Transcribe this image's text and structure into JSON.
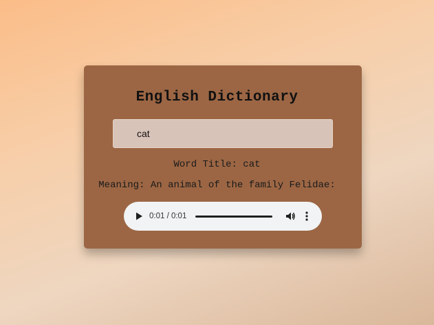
{
  "app": {
    "title": "English Dictionary"
  },
  "search": {
    "value": "cat",
    "placeholder": ""
  },
  "result": {
    "word_title": "Word Title: cat",
    "meaning": "Meaning: An animal of the family Felidae:"
  },
  "audio": {
    "time": "0:01 / 0:01",
    "progress_percent": 100,
    "icons": {
      "play": "play-icon",
      "volume": "volume-icon",
      "menu": "more-vertical-icon"
    }
  },
  "colors": {
    "card": "#9c6644",
    "input_bg": "#d8c3b8",
    "audio_bg": "#f1f3f4",
    "text": "#111111"
  }
}
